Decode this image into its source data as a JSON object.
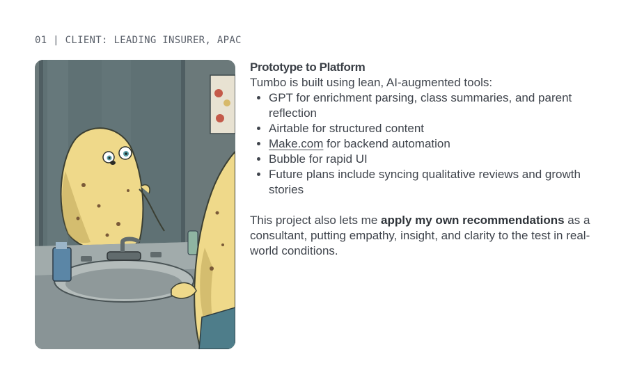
{
  "header": {
    "eyebrow": "01 | CLIENT: LEADING INSURER, APAC"
  },
  "illustration": {
    "alt": "potato-character-looking-in-mirror",
    "colors": {
      "wall": "#6b797a",
      "mirror": "#5f6f72",
      "potato": "#f1dd8c",
      "counter": "#8b9597",
      "sink": "#a7b0b0"
    }
  },
  "section": {
    "title": "Prototype to Platform",
    "intro": "Tumbo is built using lean, AI-augmented tools:",
    "tools": [
      {
        "text": "GPT for enrichment parsing, class summaries, and parent reflection"
      },
      {
        "link": "Make.com",
        "text": " for backend automation"
      },
      {
        "text": "Airtable for structured content"
      },
      {
        "text": "Bubble for rapid UI"
      },
      {
        "text": "Future plans include syncing qualitative reviews and growth stories"
      }
    ],
    "closing_before": "This project also lets me ",
    "closing_bold": "apply my own recommendations",
    "closing_after": " as a consultant, putting empathy, insight, and clarity to the test in real-world conditions."
  }
}
